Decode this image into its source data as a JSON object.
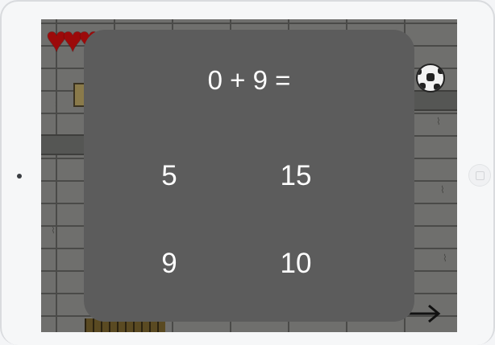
{
  "game": {
    "lives": 3,
    "icons": {
      "life": "heart-icon",
      "ball": "soccer-ball-icon",
      "next": "arrow-right-icon"
    },
    "colors": {
      "heart": "#9c0a0a",
      "dialog": "#5c5c5c",
      "wall": "#6f6f6d",
      "text": "#ffffff"
    }
  },
  "quiz": {
    "question": "0 + 9 =",
    "answers": [
      "5",
      "15",
      "9",
      "10"
    ]
  }
}
